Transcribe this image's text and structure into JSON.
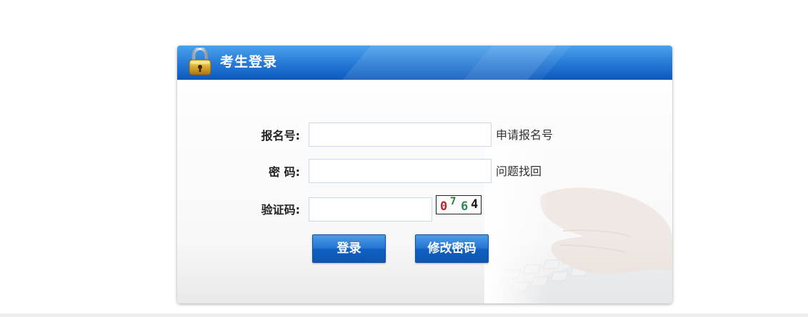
{
  "panel": {
    "title": "考生登录"
  },
  "form": {
    "reg_label": "报名号:",
    "reg_value": "",
    "reg_link": "申请报名号",
    "pwd_label": "密 码:",
    "pwd_value": "",
    "pwd_link": "问题找回",
    "captcha_label": "验证码:",
    "captcha_value": "",
    "captcha_chars": [
      "0",
      "7",
      "6",
      "4"
    ]
  },
  "buttons": {
    "login": "登录",
    "change_password": "修改密码"
  },
  "colors": {
    "header_blue": "#1667c9",
    "button_blue": "#2576d4",
    "captcha_colors": [
      "#b3262e",
      "#2c7a3a",
      "#2f8a57",
      "#1a1a1a"
    ]
  }
}
